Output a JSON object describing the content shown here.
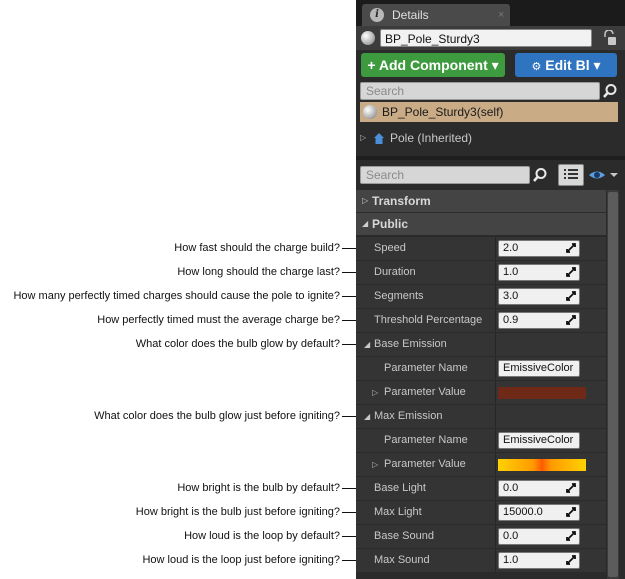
{
  "annotations": [
    {
      "text": "How fast should the charge build?",
      "target": "Speed"
    },
    {
      "text": "How long should the charge last?",
      "target": "Duration"
    },
    {
      "text": "How many perfectly timed charges should cause the pole to ignite?",
      "target": "Segments"
    },
    {
      "text": "How perfectly timed must the average charge be?",
      "target": "Threshold Percentage"
    },
    {
      "text": "What color does the bulb glow by default?",
      "target": "Base Emission"
    },
    {
      "text": "What color does the bulb glow just before igniting?",
      "target": "Max Emission"
    },
    {
      "text": "How bright is the bulb by default?",
      "target": "Base Light"
    },
    {
      "text": "How bright is the bulb just before igniting?",
      "target": "Max Light"
    },
    {
      "text": "How loud is the loop by default?",
      "target": "Base Sound"
    },
    {
      "text": "How loud is the loop just before igniting?",
      "target": "Max Sound"
    }
  ],
  "details_panel": {
    "tab": {
      "title": "Details",
      "close": "×",
      "icon": "info-icon"
    },
    "blueprint_name": "BP_Pole_Sturdy3",
    "toolbar": {
      "add_component": "+ Add Component ▾",
      "edit_blueprint": "Edit Bl ▾"
    },
    "component_search_placeholder": "Search",
    "components": [
      {
        "label": "BP_Pole_Sturdy3(self)",
        "selected": true
      },
      {
        "label": "Pole (Inherited)",
        "selected": false
      }
    ],
    "details_search_placeholder": "Search",
    "categories": [
      {
        "label": "Transform",
        "expanded": false
      },
      {
        "label": "Public",
        "expanded": true
      }
    ],
    "properties": {
      "speed": {
        "label": "Speed",
        "value": "2.0"
      },
      "duration": {
        "label": "Duration",
        "value": "1.0"
      },
      "segments": {
        "label": "Segments",
        "value": "3.0"
      },
      "threshold": {
        "label": "Threshold Percentage",
        "value": "0.9"
      },
      "base_emission": {
        "label": "Base Emission",
        "param_name_label": "Parameter Name",
        "param_name_value": "EmissiveColor",
        "param_value_label": "Parameter Value",
        "color": "#6e2a16"
      },
      "max_emission": {
        "label": "Max Emission",
        "param_name_label": "Parameter Name",
        "param_name_value": "EmissiveColor",
        "param_value_label": "Parameter Value",
        "color": "#ff9a00"
      },
      "base_light": {
        "label": "Base Light",
        "value": "0.0"
      },
      "max_light": {
        "label": "Max Light",
        "value": "15000.0"
      },
      "base_sound": {
        "label": "Base Sound",
        "value": "0.0"
      },
      "max_sound": {
        "label": "Max Sound",
        "value": "1.0"
      }
    }
  },
  "colors": {
    "add_button": "#3e9a3e",
    "edit_button": "#2f74c0",
    "selected_row": "#c9ab86"
  }
}
